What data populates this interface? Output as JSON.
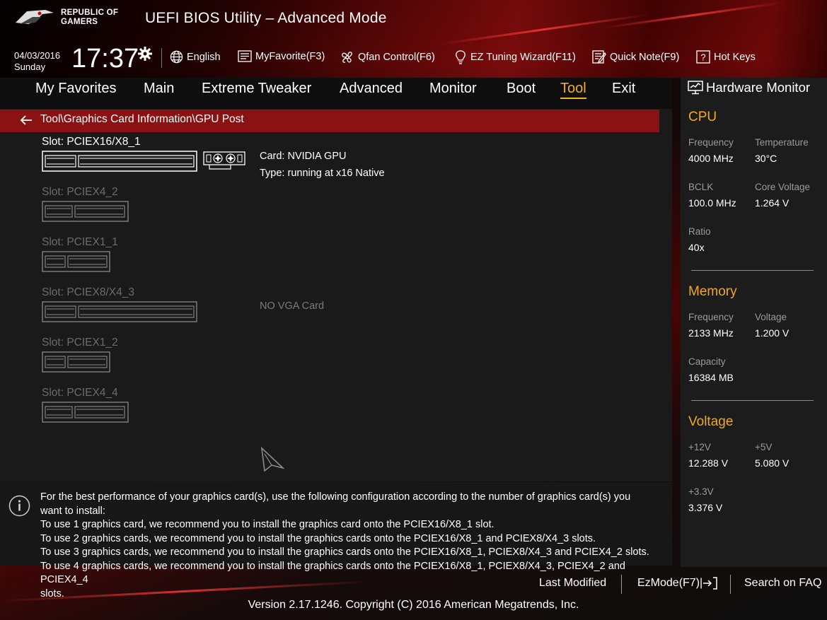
{
  "brand": {
    "line1": "REPUBLIC OF",
    "line2": "GAMERS"
  },
  "app_title": "UEFI BIOS Utility – Advanced Mode",
  "datetime": {
    "date": "04/03/2016",
    "day": "Sunday",
    "time": "17:37"
  },
  "toolbar": {
    "language": "English",
    "myfavorite": "MyFavorite(F3)",
    "qfan": "Qfan Control(F6)",
    "ez_tuning": "EZ Tuning Wizard(F11)",
    "quick_note": "Quick Note(F9)",
    "hot_keys": "Hot Keys"
  },
  "nav": {
    "tabs": [
      {
        "label": "My Favorites"
      },
      {
        "label": "Main"
      },
      {
        "label": "Extreme Tweaker"
      },
      {
        "label": "Advanced"
      },
      {
        "label": "Monitor"
      },
      {
        "label": "Boot"
      },
      {
        "label": "Tool"
      },
      {
        "label": "Exit"
      }
    ],
    "active": "Tool"
  },
  "breadcrumb": "Tool\\Graphics Card Information\\GPU Post",
  "slots": [
    {
      "label": "Slot: PCIEX16/X8_1",
      "active": true
    },
    {
      "label": "Slot: PCIEX4_2",
      "active": false
    },
    {
      "label": "Slot: PCIEX1_1",
      "active": false
    },
    {
      "label": "Slot: PCIEX8/X4_3",
      "active": false
    },
    {
      "label": "Slot: PCIEX1_2",
      "active": false
    },
    {
      "label": "Slot: PCIEX4_4",
      "active": false
    }
  ],
  "slot_info": {
    "card": "Card: NVIDIA GPU",
    "type": "Type: running at x16 Native",
    "no_vga": "NO VGA Card"
  },
  "hint": {
    "lines": [
      "For the best performance of your graphics card(s), use the following configuration according to the number of graphics card(s) you",
      "want to install:",
      "To use 1 graphics card, we recommend you to install  the graphics card onto the PCIEX16/X8_1 slot.",
      "To use 2 graphics cards, we recommend you to install the graphics cards onto the PCIEX16/X8_1 and PCIEX8/X4_3 slots.",
      "To use 3 graphics cards, we recommend you to install the graphics cards onto the PCIEX16/X8_1, PCIEX8/X4_3 and PCIEX4_2 slots.",
      "To use 4 graphics cards, we recommend you to install the graphics cards onto the PCIEX16/X8_1, PCIEX8/X4_3, PCIEX4_2 and PCIEX4_4",
      "slots."
    ]
  },
  "hw_monitor": {
    "title": "Hardware Monitor",
    "cpu": {
      "heading": "CPU",
      "frequency_label": "Frequency",
      "frequency": "4000 MHz",
      "temperature_label": "Temperature",
      "temperature": "30°C",
      "bclk_label": "BCLK",
      "bclk": "100.0 MHz",
      "core_voltage_label": "Core Voltage",
      "core_voltage": "1.264 V",
      "ratio_label": "Ratio",
      "ratio": "40x"
    },
    "memory": {
      "heading": "Memory",
      "frequency_label": "Frequency",
      "frequency": "2133 MHz",
      "voltage_label": "Voltage",
      "voltage": "1.200 V",
      "capacity_label": "Capacity",
      "capacity": "16384 MB"
    },
    "voltage": {
      "heading": "Voltage",
      "v12_label": "+12V",
      "v12": "12.288 V",
      "v5_label": "+5V",
      "v5": "5.080 V",
      "v33_label": "+3.3V",
      "v33": "3.376 V"
    }
  },
  "footer": {
    "last_modified": "Last Modified",
    "ezmode": "EzMode(F7)|",
    "search_faq": "Search on FAQ",
    "version": "Version 2.17.1246. Copyright (C) 2016 American Megatrends, Inc."
  },
  "colors": {
    "accent": "#f0b020",
    "header_red": "#8a1212",
    "hw_heading": "#f0a820"
  },
  "icons": [
    "rog-logo-icon",
    "gear-icon",
    "globe-icon",
    "myfavorite-icon",
    "fan-icon",
    "lightbulb-icon",
    "note-icon",
    "help-icon",
    "monitor-icon",
    "back-arrow-icon",
    "info-icon",
    "exit-icon",
    "gpu-card-icon",
    "cursor-icon"
  ]
}
